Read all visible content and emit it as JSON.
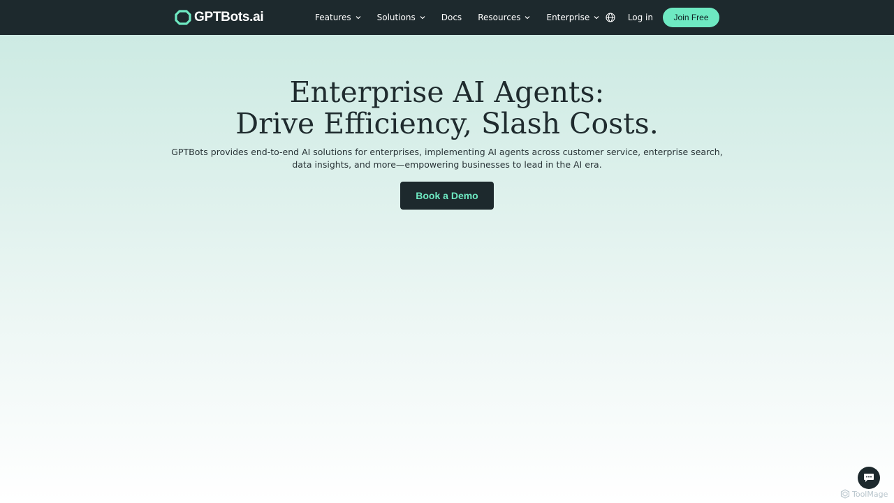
{
  "brand": {
    "name": "GPTBots.ai",
    "accent": "#6ee9c2",
    "dark": "#1d292d"
  },
  "nav": {
    "items": [
      {
        "label": "Features",
        "has_dropdown": true
      },
      {
        "label": "Solutions",
        "has_dropdown": true
      },
      {
        "label": "Docs",
        "has_dropdown": false
      },
      {
        "label": "Resources",
        "has_dropdown": true
      },
      {
        "label": "Enterprise",
        "has_dropdown": true
      }
    ],
    "globe_icon": "globe-icon",
    "login_label": "Log in",
    "join_label": "Join Free"
  },
  "hero": {
    "title_line1": "Enterprise AI Agents:",
    "title_line2": "Drive Efficiency, Slash Costs.",
    "description": "GPTBots provides end-to-end AI solutions for enterprises, implementing AI agents across customer service, enterprise search, data insights, and more—empowering businesses to lead in the AI era.",
    "cta_label": "Book a Demo"
  },
  "chat": {
    "icon": "chat-bubble-icon"
  },
  "watermark": {
    "text": "ToolMage"
  }
}
